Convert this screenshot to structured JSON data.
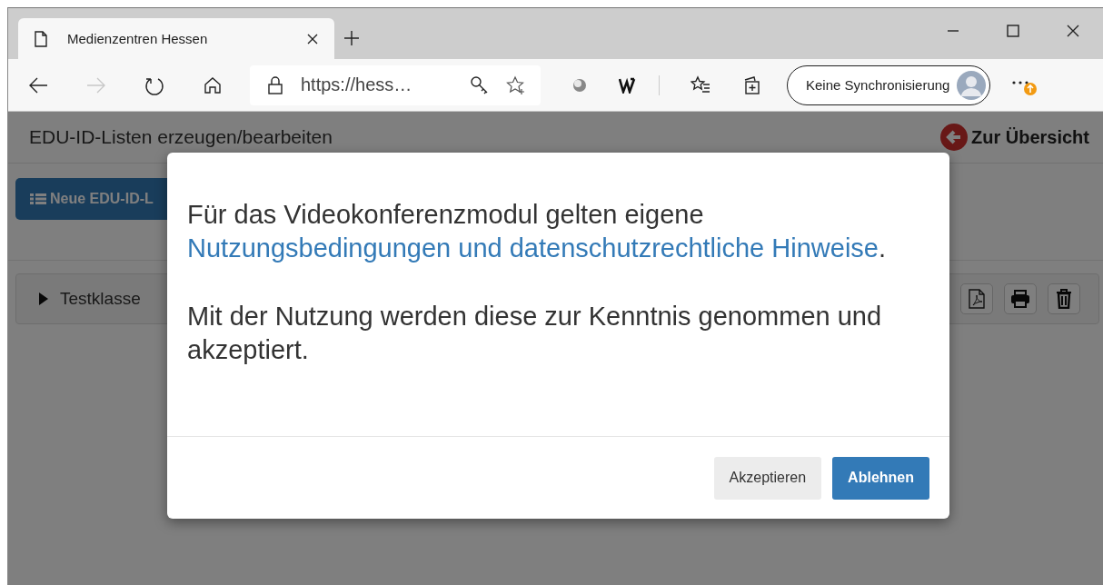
{
  "browser": {
    "tabs": [
      {
        "title": "Medienzentren Hessen",
        "selected": true
      }
    ],
    "nav": [
      {
        "kind": "back",
        "disabled": false
      },
      {
        "kind": "forward",
        "disabled": true
      },
      {
        "kind": "refresh",
        "disabled": false
      },
      {
        "kind": "home",
        "disabled": false
      }
    ],
    "address": "https://hess…",
    "profile_button": "Keine Synchronisierung"
  },
  "page": {
    "title": "EDU-ID-Listen erzeugen/bearbeiten",
    "back_link": "Zur Übersicht",
    "new_button": "Neue EDU-ID-L",
    "lists": [
      {
        "name": "Testklasse",
        "expanded": false
      }
    ]
  },
  "modal": {
    "paragraphs": [
      {
        "before": "Für das Videokonferenzmodul gelten eigene ",
        "link": "Nutzungsbedingungen und datenschutzrechtliche Hinweise",
        "after": "."
      },
      {
        "before": "Mit der Nutzung werden diese zur Kenntnis genommen und akzeptiert."
      }
    ],
    "buttons": [
      {
        "label": "Akzeptieren",
        "kind": "secondary"
      },
      {
        "label": "Ablehnen",
        "kind": "primary"
      }
    ]
  }
}
